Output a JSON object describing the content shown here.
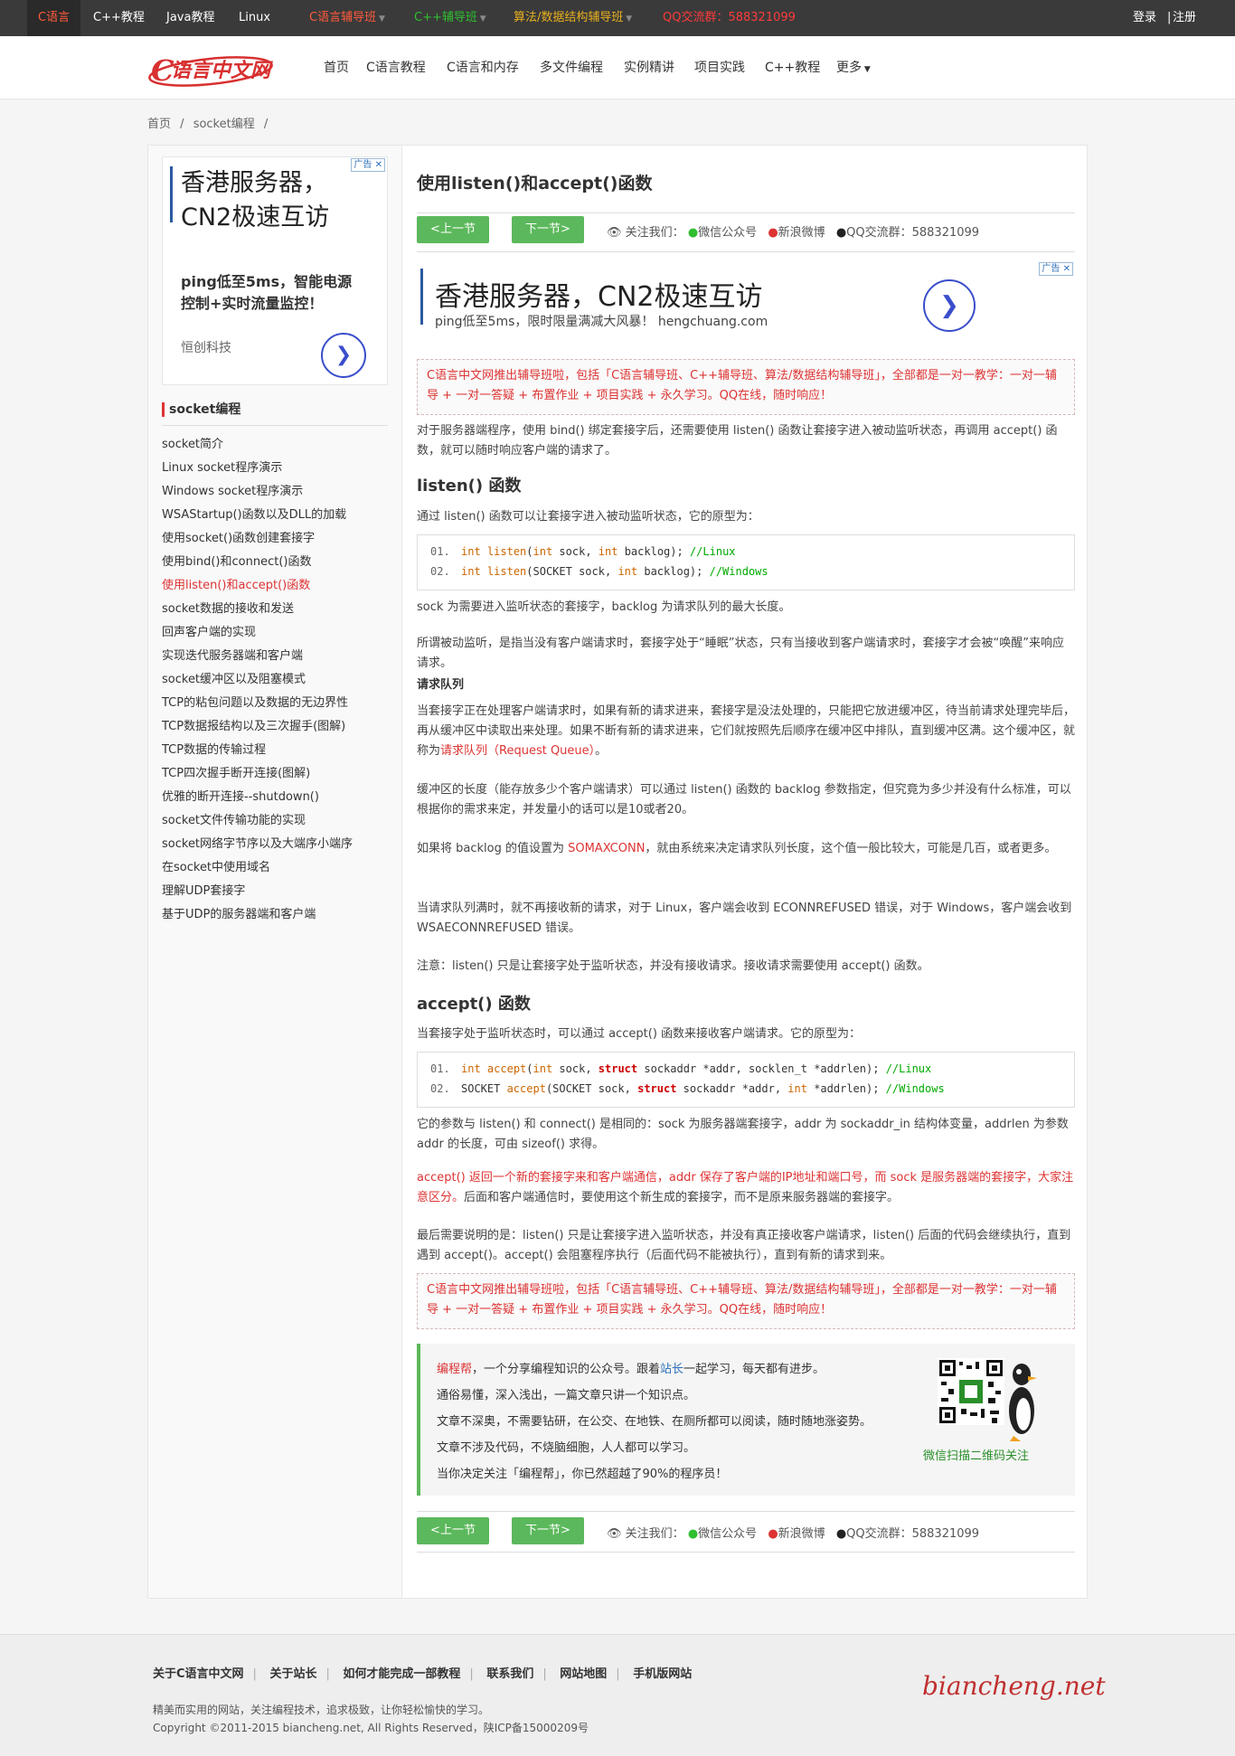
{
  "topbar": {
    "items": [
      "C语言",
      "C++教程",
      "Java教程",
      "Linux",
      "C语言辅导班",
      "C++辅导班",
      "算法/数据结构辅导班",
      "QQ交流群：588321099"
    ],
    "login": "登录",
    "sep": "|",
    "register": "注册"
  },
  "mainnav": {
    "logo": "C语言中文网",
    "items": [
      "首页",
      "C语言教程",
      "C语言和内存",
      "多文件编程",
      "实例精讲",
      "项目实践",
      "C++教程",
      "更多"
    ]
  },
  "breadcrumb": {
    "home": "首页",
    "sep": "/",
    "section": "socket编程",
    "sep2": "/"
  },
  "side_ad": {
    "tag": "广告",
    "line1": "香港服务器，",
    "line2": "CN2极速互访",
    "desc": "ping低至5ms，智能电源控制+实时流量监控！",
    "company": "恒创科技",
    "arrow": "❯"
  },
  "sidebar": {
    "title": "socket编程",
    "items": [
      "socket简介",
      "Linux socket程序演示",
      "Windows socket程序演示",
      "WSAStartup()函数以及DLL的加载",
      "使用socket()函数创建套接字",
      "使用bind()和connect()函数",
      "使用listen()和accept()函数",
      "socket数据的接收和发送",
      "回声客户端的实现",
      "实现迭代服务器端和客户端",
      "socket缓冲区以及阻塞模式",
      "TCP的粘包问题以及数据的无边界性",
      "TCP数据报结构以及三次握手(图解)",
      "TCP数据的传输过程",
      "TCP四次握手断开连接(图解)",
      "优雅的断开连接--shutdown()",
      "socket文件传输功能的实现",
      "socket网络字节序以及大端序小端序",
      "在socket中使用域名",
      "理解UDP套接字",
      "基于UDP的服务器端和客户端"
    ]
  },
  "article": {
    "title": "使用listen()和accept()函数",
    "prev": "<上一节",
    "next": "下一节>",
    "follow": "关注我们：",
    "wechat": "微信公众号",
    "weibo": "新浪微博",
    "qq": "QQ交流群：588321099",
    "top_ad": {
      "tag": "广告",
      "line1": "香港服务器，CN2极速互访",
      "line2": "ping低至5ms，限时限量满减大风暴！ hengchuang.com",
      "arrow": "❯"
    },
    "notice": "C语言中文网推出辅导班啦，包括「C语言辅导班、C++辅导班、算法/数据结构辅导班」，全部都是一对一教学：一对一辅导 + 一对一答疑 + 布置作业 + 项目实践 + 永久学习。QQ在线，随时响应！",
    "intro": "对于服务器端程序，使用 bind() 绑定套接字后，还需要使用 listen() 函数让套接字进入被动监听状态，再调用 accept() 函数，就可以随时响应客户端的请求了。",
    "h_listen": "listen() 函数",
    "listen_p1": "通过 listen() 函数可以让套接字进入被动监听状态，它的原型为：",
    "code1": {
      "l1": {
        "num": "01.",
        "kw1": "int",
        "fn": "listen",
        "kw2": "int",
        "rest1": " sock, ",
        "kw3": "int",
        "rest2": " backlog);  ",
        "cm": "//Linux"
      },
      "l2": {
        "num": "02.",
        "kw1": "int",
        "fn": "listen",
        "rest0": "(SOCKET sock, ",
        "kw3": "int",
        "rest2": " backlog);  ",
        "cm": "//Windows"
      }
    },
    "listen_p2": "sock 为需要进入监听状态的套接字，backlog 为请求队列的最大长度。",
    "listen_p3": "所谓被动监听，是指当没有客户端请求时，套接字处于“睡眠”状态，只有当接收到客户端请求时，套接字才会被“唤醒”来响应请求。",
    "queue_h": "请求队列",
    "queue_p1a": "当套接字正在处理客户端请求时，如果有新的请求进来，套接字是没法处理的，只能把它放进缓冲区，待当前请求处理完毕后，再从缓冲区中读取出来处理。如果不断有新的请求进来，它们就按照先后顺序在缓冲区中排队，直到缓冲区满。这个缓冲区，就称为",
    "queue_p1b": "请求队列（Request Queue）",
    "queue_p1c": "。",
    "queue_p2": "缓冲区的长度（能存放多少个客户端请求）可以通过 listen() 函数的 backlog 参数指定，但究竟为多少并没有什么标准，可以根据你的需求来定，并发量小的话可以是10或者20。",
    "queue_p3a": "如果将 backlog 的值设置为 ",
    "queue_p3b": "SOMAXCONN",
    "queue_p3c": "，就由系统来决定请求队列长度，这个值一般比较大，可能是几百，或者更多。",
    "queue_p4": "当请求队列满时，就不再接收新的请求，对于 Linux，客户端会收到 ECONNREFUSED 错误，对于 Windows，客户端会收到 WSAECONNREFUSED 错误。",
    "queue_p5": "注意：listen() 只是让套接字处于监听状态，并没有接收请求。接收请求需要使用 accept() 函数。",
    "h_accept": "accept() 函数",
    "accept_p1": "当套接字处于监听状态时，可以通过 accept() 函数来接收客户端请求。它的原型为：",
    "code2": {
      "l1": {
        "num": "01.",
        "kw1": "int",
        "fn": "accept",
        "kw2": "int",
        "rest1": " sock, ",
        "st": "struct",
        "rest2": " sockaddr *addr, socklen_t *addrlen);  ",
        "cm": "//Linux"
      },
      "l2": {
        "num": "02.",
        "rest0": "SOCKET ",
        "fn": "accept",
        "rest1": "(SOCKET sock, ",
        "st": "struct",
        "rest2": " sockaddr *addr, ",
        "kw3": "int",
        "rest3": " *addrlen);  ",
        "cm": "//Windows"
      }
    },
    "accept_p2": "它的参数与 listen() 和 connect() 是相同的：sock 为服务器端套接字，addr 为 sockaddr_in 结构体变量，addrlen 为参数 addr 的长度，可由 sizeof() 求得。",
    "accept_p3a": "accept() 返回一个新的套接字来和客户端通信，addr 保存了客户端的IP地址和端口号，而 sock 是服务器端的套接字，大家注意区分。",
    "accept_p3b": "后面和客户端通信时，要使用这个新生成的套接字，而不是原来服务器端的套接字。",
    "accept_p4": "最后需要说明的是：listen() 只是让套接字进入监听状态，并没有真正接收客户端请求，listen() 后面的代码会继续执行，直到遇到 accept()。accept() 会阻塞程序执行（后面代码不能被执行），直到有新的请求到来。",
    "gzh": {
      "l1a": "编程帮",
      "l1b": "，一个分享编程知识的公众号。跟着",
      "l1c": "站长",
      "l1d": "一起学习，每天都有进步。",
      "l2": "通俗易懂，深入浅出，一篇文章只讲一个知识点。",
      "l3": "文章不深奥，不需要钻研，在公交、在地铁、在厕所都可以阅读，随时随地涨姿势。",
      "l4": "文章不涉及代码，不烧脑细胞，人人都可以学习。",
      "l5": "当你决定关注「编程帮」，你已然超越了90%的程序员！",
      "qr_label": "微信扫描二维码关注"
    }
  },
  "footer": {
    "links": [
      "关于C语言中文网",
      "关于站长",
      "如何才能完成一部教程",
      "联系我们",
      "网站地图",
      "手机版网站"
    ],
    "sep": "|",
    "slogan": "精美而实用的网站，关注编程技术，追求极致，让你轻松愉快的学习。",
    "copyright": "Copyright ©2011-2015 biancheng.net, All Rights Reserved，陕ICP备15000209号",
    "brand": "biancheng.net"
  },
  "colors": {
    "accent_red": "#d33333",
    "green": "#5cb85c",
    "link_blue": "#2b6fb8"
  }
}
